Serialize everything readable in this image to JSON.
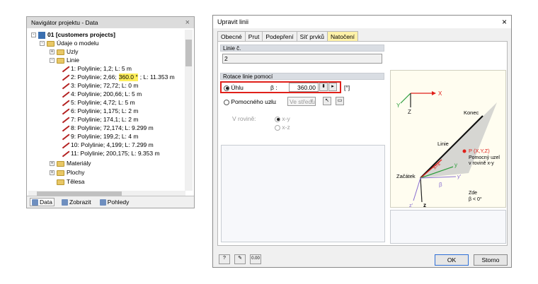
{
  "navigator": {
    "title": "Navigátor projektu - Data",
    "close": "×",
    "tree": {
      "project": "01 [customers projects]",
      "model_data": "Údaje o modelu",
      "nodes": "Uzly",
      "lines": "Linie",
      "items": [
        "1: Polylinie; 1,2; L: 5 m",
        "2: Polylinie; 2,66; 360.0 °; L: 11.353 m",
        "3: Polylinie; 72,72; L: 0 m",
        "4: Polylinie; 200,66; L: 5 m",
        "5: Polylinie; 4,72; L: 5 m",
        "6: Polylinie; 1,175; L: 2 m",
        "7: Polylinie; 174,1; L: 2 m",
        "8: Polylinie; 72,174; L: 9.299 m",
        "9: Polylinie; 199,2; L: 4 m",
        "10: Polylinie; 4,199; L: 7.299 m",
        "11: Polylinie; 200,175; L: 9.353 m"
      ],
      "item2_prefix": "2: Polylinie; 2,66; ",
      "item2_highlight": "360.0 °",
      "item2_suffix": "; L: 11.353 m",
      "materials": "Materiály",
      "surfaces": "Plochy",
      "solids": "Tělesa"
    },
    "tabs": [
      "Data",
      "Zobrazit",
      "Pohledy"
    ]
  },
  "dialog": {
    "title": "Upravit linii",
    "close": "×",
    "tabs": [
      "Obecné",
      "Prut",
      "Podepření",
      "Síť prvků",
      "Natočení"
    ],
    "active_tab": "Natočení",
    "line_no_label": "Linie č.",
    "line_no_value": "2",
    "rotation_label": "Rotace linie pomocí",
    "angle_option": "Úhlu",
    "beta_label": "β :",
    "beta_value": "360.00",
    "beta_unit": "[°]",
    "helper_node_option": "Pomocného uzlu",
    "helper_node_sym": "č.:",
    "helper_node_select": "Ve středu",
    "in_plane_label": "V rovině:",
    "plane_xy": "x-y",
    "plane_xz": "x-z",
    "ok": "OK",
    "cancel": "Storno"
  },
  "figure": {
    "end": "Konec",
    "line": "Linie",
    "start": "Začátek",
    "point": "P (X,Y,Z)",
    "helper1": "Pomocný uzel",
    "helper2": "v rovině x-y",
    "here": "Zde",
    "beta_cond": "β < 0°",
    "X": "X",
    "Y": "Y",
    "Z": "Z",
    "x_eq": "x=x'",
    "y": "y",
    "y_prime": "y'",
    "z": "z",
    "z_prime": "z'",
    "beta": "β"
  },
  "colors": {
    "accent_red": "#e0201a",
    "tab_highlight": "#fff2a8",
    "tree_highlight": "#ffef5c"
  }
}
